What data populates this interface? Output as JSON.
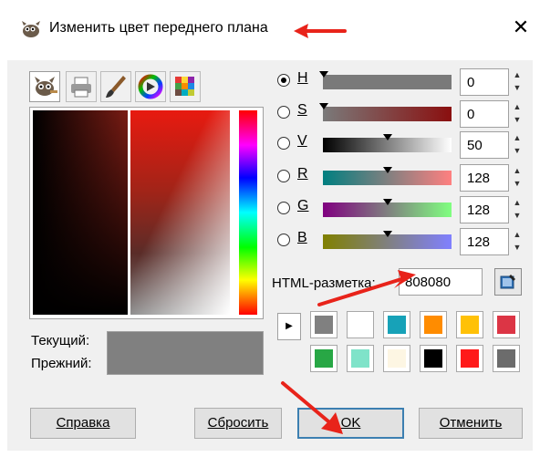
{
  "window": {
    "title": "Изменить цвет переднего плана",
    "close_glyph": "✕"
  },
  "selector_tabs": [
    {
      "name": "gimp-selector",
      "icon": "gimp-icon",
      "active": true
    },
    {
      "name": "printer-cmyk",
      "icon": "printer-icon",
      "active": false
    },
    {
      "name": "watercolor",
      "icon": "paintbrush-icon",
      "active": false
    },
    {
      "name": "color-wheel",
      "icon": "color-wheel-icon",
      "active": false
    },
    {
      "name": "palette",
      "icon": "palette-icon",
      "active": false
    }
  ],
  "compare": {
    "current_label": "Текущий:",
    "previous_label": "Прежний:",
    "current_color": "#808080",
    "previous_color": "#808080"
  },
  "channels": [
    {
      "letter": "H",
      "value": "0",
      "selected": true
    },
    {
      "letter": "S",
      "value": "0",
      "selected": false
    },
    {
      "letter": "V",
      "value": "50",
      "selected": false
    },
    {
      "letter": "R",
      "value": "128",
      "selected": false
    },
    {
      "letter": "G",
      "value": "128",
      "selected": false
    },
    {
      "letter": "B",
      "value": "128",
      "selected": false
    }
  ],
  "html_notation": {
    "label": "HTML-разметка:",
    "value": "808080"
  },
  "history": {
    "expand_glyph": "▶",
    "colors": [
      "#808080",
      "#ffffff",
      "#17a2b8",
      "#ff8c00",
      "#ffc107",
      "#dc3545",
      "#28a745",
      "#7fe3c9",
      "#fdf6e3",
      "#000000",
      "#ff1a1a",
      "#6c6c6c"
    ]
  },
  "buttons": {
    "help": "Справка",
    "reset": "Сбросить",
    "ok": "OK",
    "cancel": "Отменить"
  },
  "colors": {
    "annotation_arrow": "#e8231a",
    "default_button_border": "#3c7fb1"
  }
}
